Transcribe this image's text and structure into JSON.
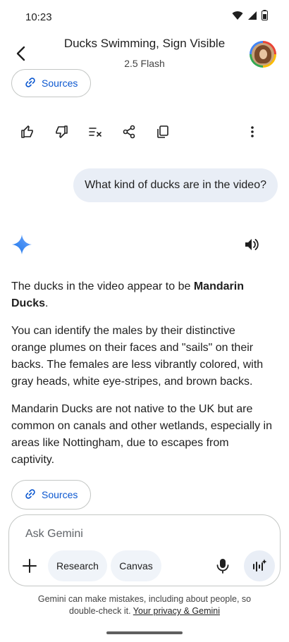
{
  "status_bar": {
    "time": "10:23"
  },
  "header": {
    "title": "Ducks Swimming, Sign Visible",
    "subtitle": "2.5 Flash"
  },
  "top_sources_label": "Sources",
  "user_message": "What kind of ducks are in the video?",
  "answer": {
    "p1_prefix": "The ducks in the video appear to be ",
    "p1_bold": "Mandarin Ducks",
    "p1_suffix": ".",
    "p2": "You can identify the males by their distinctive orange plumes on their faces and \"sails\" on their backs. The females are less vibrantly colored, with gray heads, white eye-stripes, and brown backs.",
    "p3": "Mandarin Ducks are not native to the UK but are common on canals and other wetlands, especially in areas like Nottingham, due to escapes from captivity."
  },
  "bottom_sources_label": "Sources",
  "input": {
    "placeholder": "Ask Gemini",
    "research_label": "Research",
    "canvas_label": "Canvas"
  },
  "disclaimer": {
    "text": "Gemini can make mistakes, including about people, so double-check it. ",
    "link": "Your privacy & Gemini"
  },
  "colors": {
    "accent": "#0b57d0",
    "bubble": "#e9eef6",
    "pill": "#f0f4f9"
  }
}
